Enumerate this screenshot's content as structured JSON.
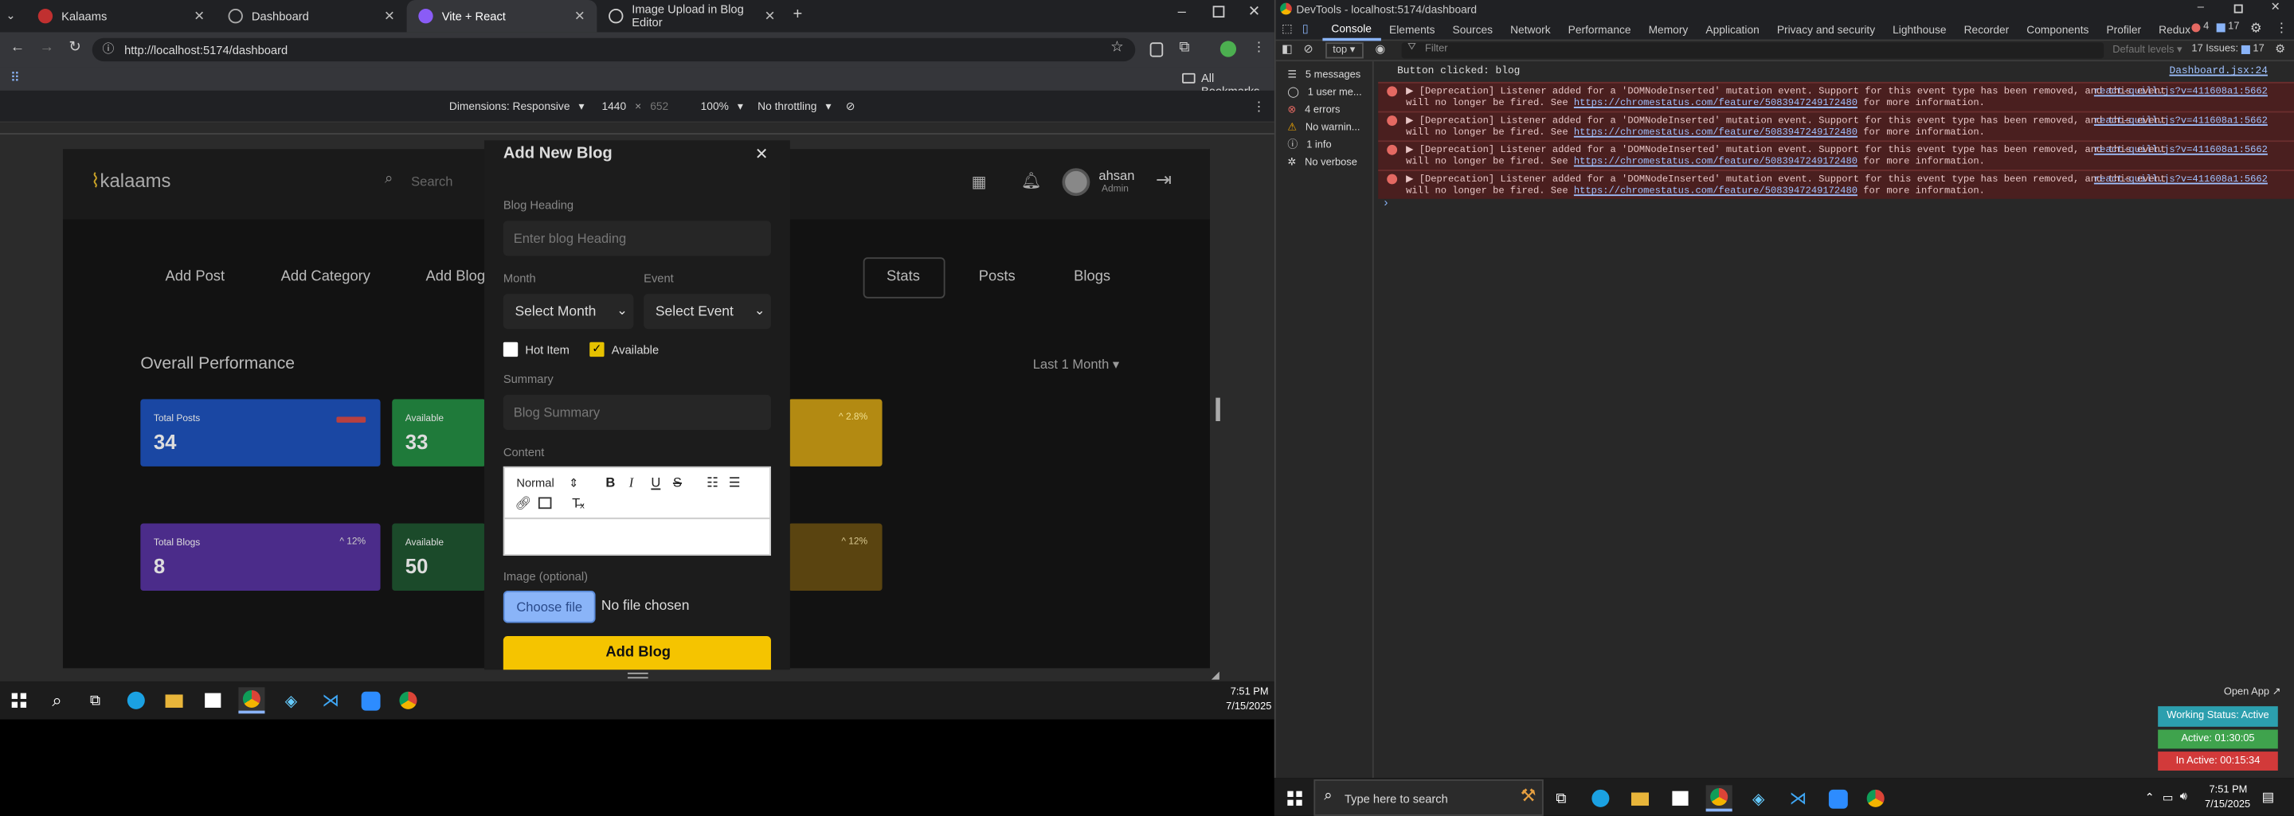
{
  "browser": {
    "tabs": [
      "Kalaams",
      "Dashboard",
      "Vite + React",
      "Image Upload in Blog Editor"
    ],
    "url": "http://localhost:5174/dashboard",
    "bookmarks_label": "All Bookmarks",
    "device": {
      "dimensions": "Dimensions: Responsive",
      "width": "1440",
      "height": "652",
      "zoom": "100%",
      "throttle": "No throttling"
    }
  },
  "app": {
    "logo": "kalaams",
    "search_placeholder": "Search",
    "user": {
      "name": "ahsan",
      "role": "Admin"
    },
    "nav_left": [
      "Add Post",
      "Add Category",
      "Add Blog"
    ],
    "nav_right": [
      "Stats",
      "Posts",
      "Blogs"
    ],
    "section_title": "Overall Performance",
    "range": "Last 1 Month",
    "cards": [
      {
        "label": "Total Posts",
        "value": "34",
        "pct": "",
        "color": "#1a47a3"
      },
      {
        "label": "Available",
        "value": "33",
        "pct": "",
        "color": "#1f7a3a"
      },
      {
        "label": "",
        "value": "",
        "pct": "^ 2.8%",
        "color": "#b38a12"
      },
      {
        "label": "Total Blogs",
        "value": "8",
        "pct": "^ 12%",
        "color": "#4b2c8a"
      },
      {
        "label": "Available",
        "value": "50",
        "pct": "",
        "color": "#1b4a2a"
      },
      {
        "label": "",
        "value": "",
        "pct": "^ 12%",
        "color": "#5a4410"
      }
    ]
  },
  "modal": {
    "title": "Add New Blog",
    "heading_label": "Blog Heading",
    "heading_placeholder": "Enter blog Heading",
    "month_label": "Month",
    "month_value": "Select Month",
    "event_label": "Event",
    "event_value": "Select Event",
    "hot_item": "Hot Item",
    "available": "Available",
    "summary_label": "Summary",
    "summary_placeholder": "Blog Summary",
    "content_label": "Content",
    "editor_format": "Normal",
    "image_label": "Image (optional)",
    "choose_file": "Choose file",
    "no_file": "No file chosen",
    "submit": "Add Blog"
  },
  "devtools": {
    "title": "DevTools - localhost:5174/dashboard",
    "tabs": [
      "Console",
      "Elements",
      "Sources",
      "Network",
      "Performance",
      "Memory",
      "Application",
      "Privacy and security",
      "Lighthouse",
      "Recorder",
      "Components",
      "Profiler",
      "Redux"
    ],
    "errors_count": "4",
    "issues_count": "17",
    "issues_label": "17 Issues:",
    "issues_badge": "17",
    "context": "top",
    "filter_placeholder": "Filter",
    "levels": "Default levels",
    "sidebar": [
      "5 messages",
      "1 user me...",
      "4 errors",
      "No warnin...",
      "1 info",
      "No verbose"
    ],
    "log": {
      "text": "Button clicked: blog",
      "source": "Dashboard.jsx:24"
    },
    "error_line1": "[Deprecation] Listener added for a 'DOMNodeInserted' mutation event. Support for this event type has been removed, and this event",
    "error_line2a": "will no longer be fired. See ",
    "error_link": "https://chromestatus.com/feature/5083947249172480",
    "error_line2b": " for more information.",
    "error_source": "react-quill.js?v=411608a1:5662"
  },
  "status_widget": {
    "open_app": "Open App",
    "working": "Working Status: Active",
    "active": "Active: 01:30:05",
    "inactive": "In Active: 00:15:34"
  },
  "taskbar": {
    "left_time": "7:51 PM",
    "left_date": "7/15/2025",
    "right_time": "7:51 PM",
    "right_date": "7/15/2025",
    "search_placeholder": "Type here to search"
  }
}
